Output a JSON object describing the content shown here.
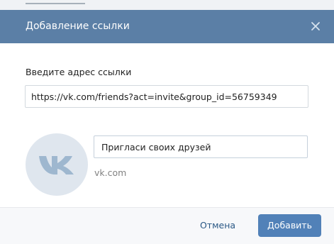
{
  "dialog": {
    "title": "Добавление ссылки",
    "close_icon": "close-icon"
  },
  "form": {
    "url_label": "Введите адрес ссылки",
    "url_value": "https://vk.com/friends?act=invite&group_id=56759349",
    "link_title_value": "Пригласи своих друзей",
    "domain": "vk.com",
    "avatar_icon": "vk-logo-icon"
  },
  "footer": {
    "cancel_label": "Отмена",
    "add_label": "Добавить"
  },
  "colors": {
    "header_bg": "#5b7fa6",
    "primary_button": "#5181b8",
    "link": "#2a5885",
    "avatar_bg": "#dfe6ee",
    "logo": "#9eb7cf"
  }
}
